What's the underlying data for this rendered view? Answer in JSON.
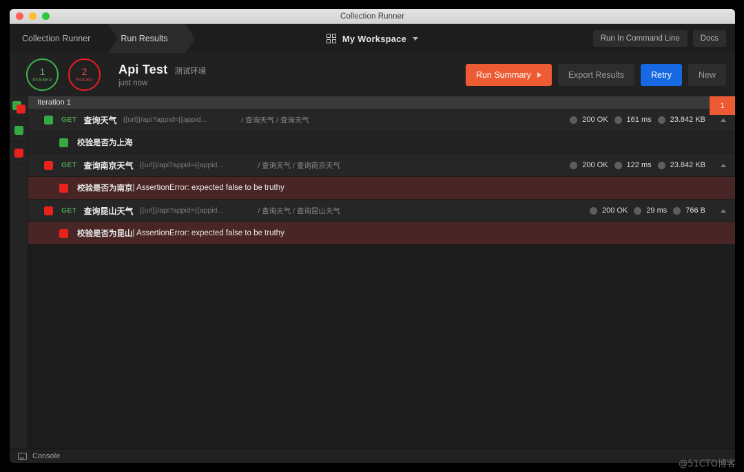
{
  "window": {
    "title": "Collection Runner",
    "traffic_lights": [
      "close-red",
      "minimize-yellow",
      "maximize-green"
    ]
  },
  "topnav": {
    "crumbs": [
      {
        "label": "Collection Runner",
        "active": false
      },
      {
        "label": "Run Results",
        "active": true
      }
    ],
    "workspace": {
      "icon": "grid-icon",
      "name": "My Workspace",
      "caret": "chevron-down-icon"
    },
    "buttons": [
      {
        "label": "Run In Command Line"
      },
      {
        "label": "Docs"
      }
    ]
  },
  "summary": {
    "passed": {
      "count": "1",
      "label": "PASSED",
      "color": "#3cb44a"
    },
    "failed": {
      "count": "2",
      "label": "FAILED",
      "color": "#ee1b21"
    },
    "run_title": "Api Test",
    "environment": "测试环境",
    "run_time": "just now",
    "actions": [
      {
        "label": "Run Summary",
        "style": "primary",
        "color": "#ec5b33",
        "caret": "play-triangle-icon"
      },
      {
        "label": "Export Results",
        "style": "ghost"
      },
      {
        "label": "Retry",
        "style": "blue",
        "color": "#1668e3"
      },
      {
        "label": "New",
        "style": "ghost"
      }
    ]
  },
  "rail": [
    {
      "icon": "mixed-result-squares",
      "status": "mixed"
    },
    {
      "icon": "pass-square",
      "status": "pass"
    },
    {
      "icon": "fail-square",
      "status": "fail"
    }
  ],
  "iteration": {
    "label": "Iteration 1",
    "badge": "1"
  },
  "requests": [
    {
      "status": "pass",
      "method": "GET",
      "name": "查询天气",
      "url": "{{url}}/api?appid={{appid...",
      "path": "/ 查询天气 / 查询天气",
      "code": "200 OK",
      "time": "161 ms",
      "size": "23.842 KB",
      "collapse": "chevron-up-icon",
      "tests": [
        {
          "status": "pass",
          "name": "校验是否为上海",
          "error": ""
        }
      ]
    },
    {
      "status": "fail",
      "method": "GET",
      "name": "查询南京天气",
      "url": "{{url}}/api?appid={{appid...",
      "path": "/ 查询天气 / 查询南京天气",
      "code": "200 OK",
      "time": "122 ms",
      "size": "23.842 KB",
      "collapse": "chevron-up-icon",
      "tests": [
        {
          "status": "fail",
          "name": "校验是否为南京",
          "error": " | AssertionError: expected false to be truthy"
        }
      ]
    },
    {
      "status": "fail",
      "method": "GET",
      "name": "查询昆山天气",
      "url": "{{url}}/api?appid={{appid...",
      "path": "/ 查询天气 / 查询昆山天气",
      "code": "200 OK",
      "time": "29 ms",
      "size": "766 B",
      "collapse": "chevron-up-icon",
      "tests": [
        {
          "status": "fail",
          "name": "校验是否为昆山",
          "error": " | AssertionError: expected false to be truthy"
        }
      ]
    }
  ],
  "footer": {
    "console_label": "Console",
    "console_icon": "terminal-icon"
  },
  "watermark": "@51CTO博客"
}
